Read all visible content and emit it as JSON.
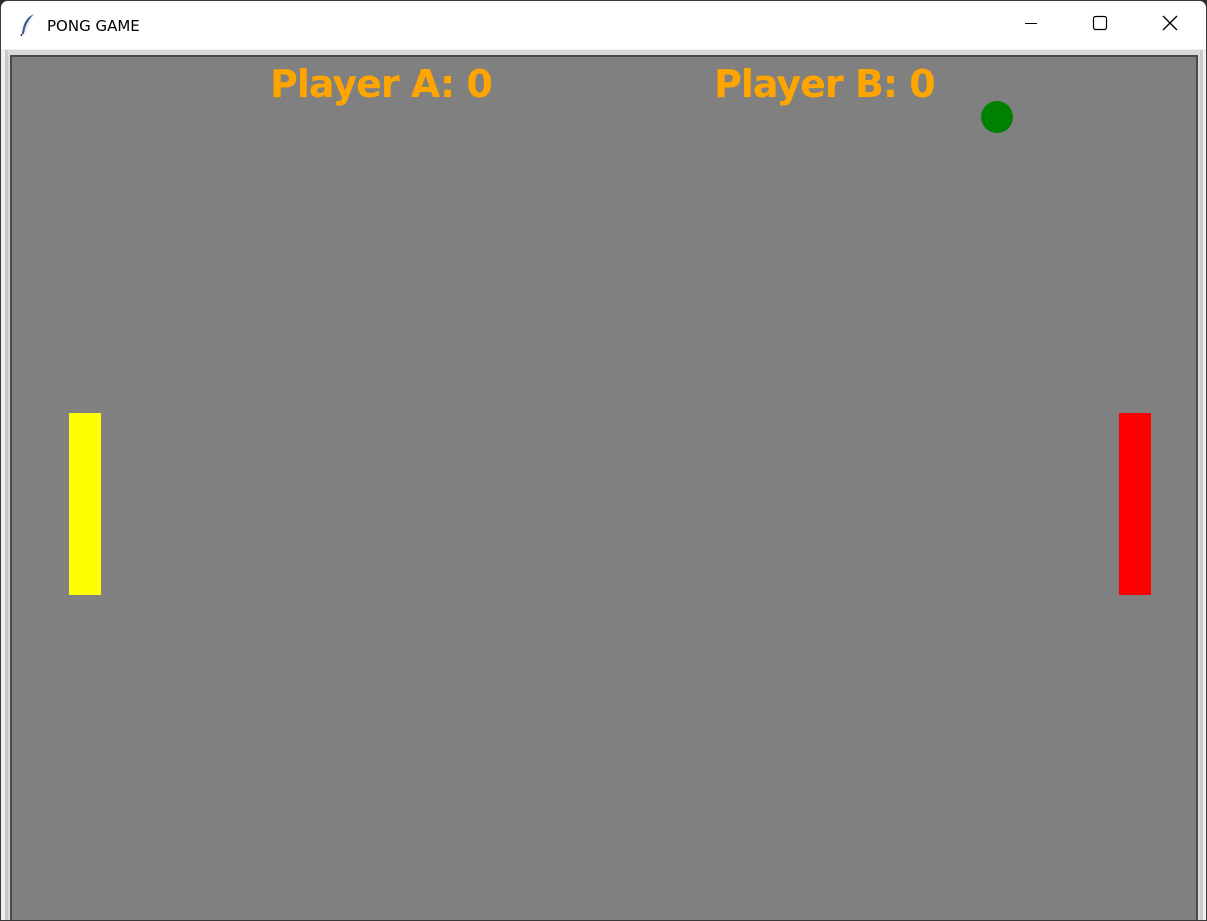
{
  "window": {
    "title": "PONG GAME",
    "controls": {
      "minimize_icon": "minimize-icon",
      "maximize_icon": "maximize-icon",
      "close_icon": "close-icon"
    }
  },
  "game": {
    "canvas_color": "#808080",
    "score_color": "#ffa500",
    "player_a": {
      "label": "Player A: 0",
      "score": 0,
      "paddle_color": "#ffff00"
    },
    "player_b": {
      "label": "Player B: 0",
      "score": 0,
      "paddle_color": "#ff0000"
    },
    "ball": {
      "color": "#008000"
    }
  }
}
